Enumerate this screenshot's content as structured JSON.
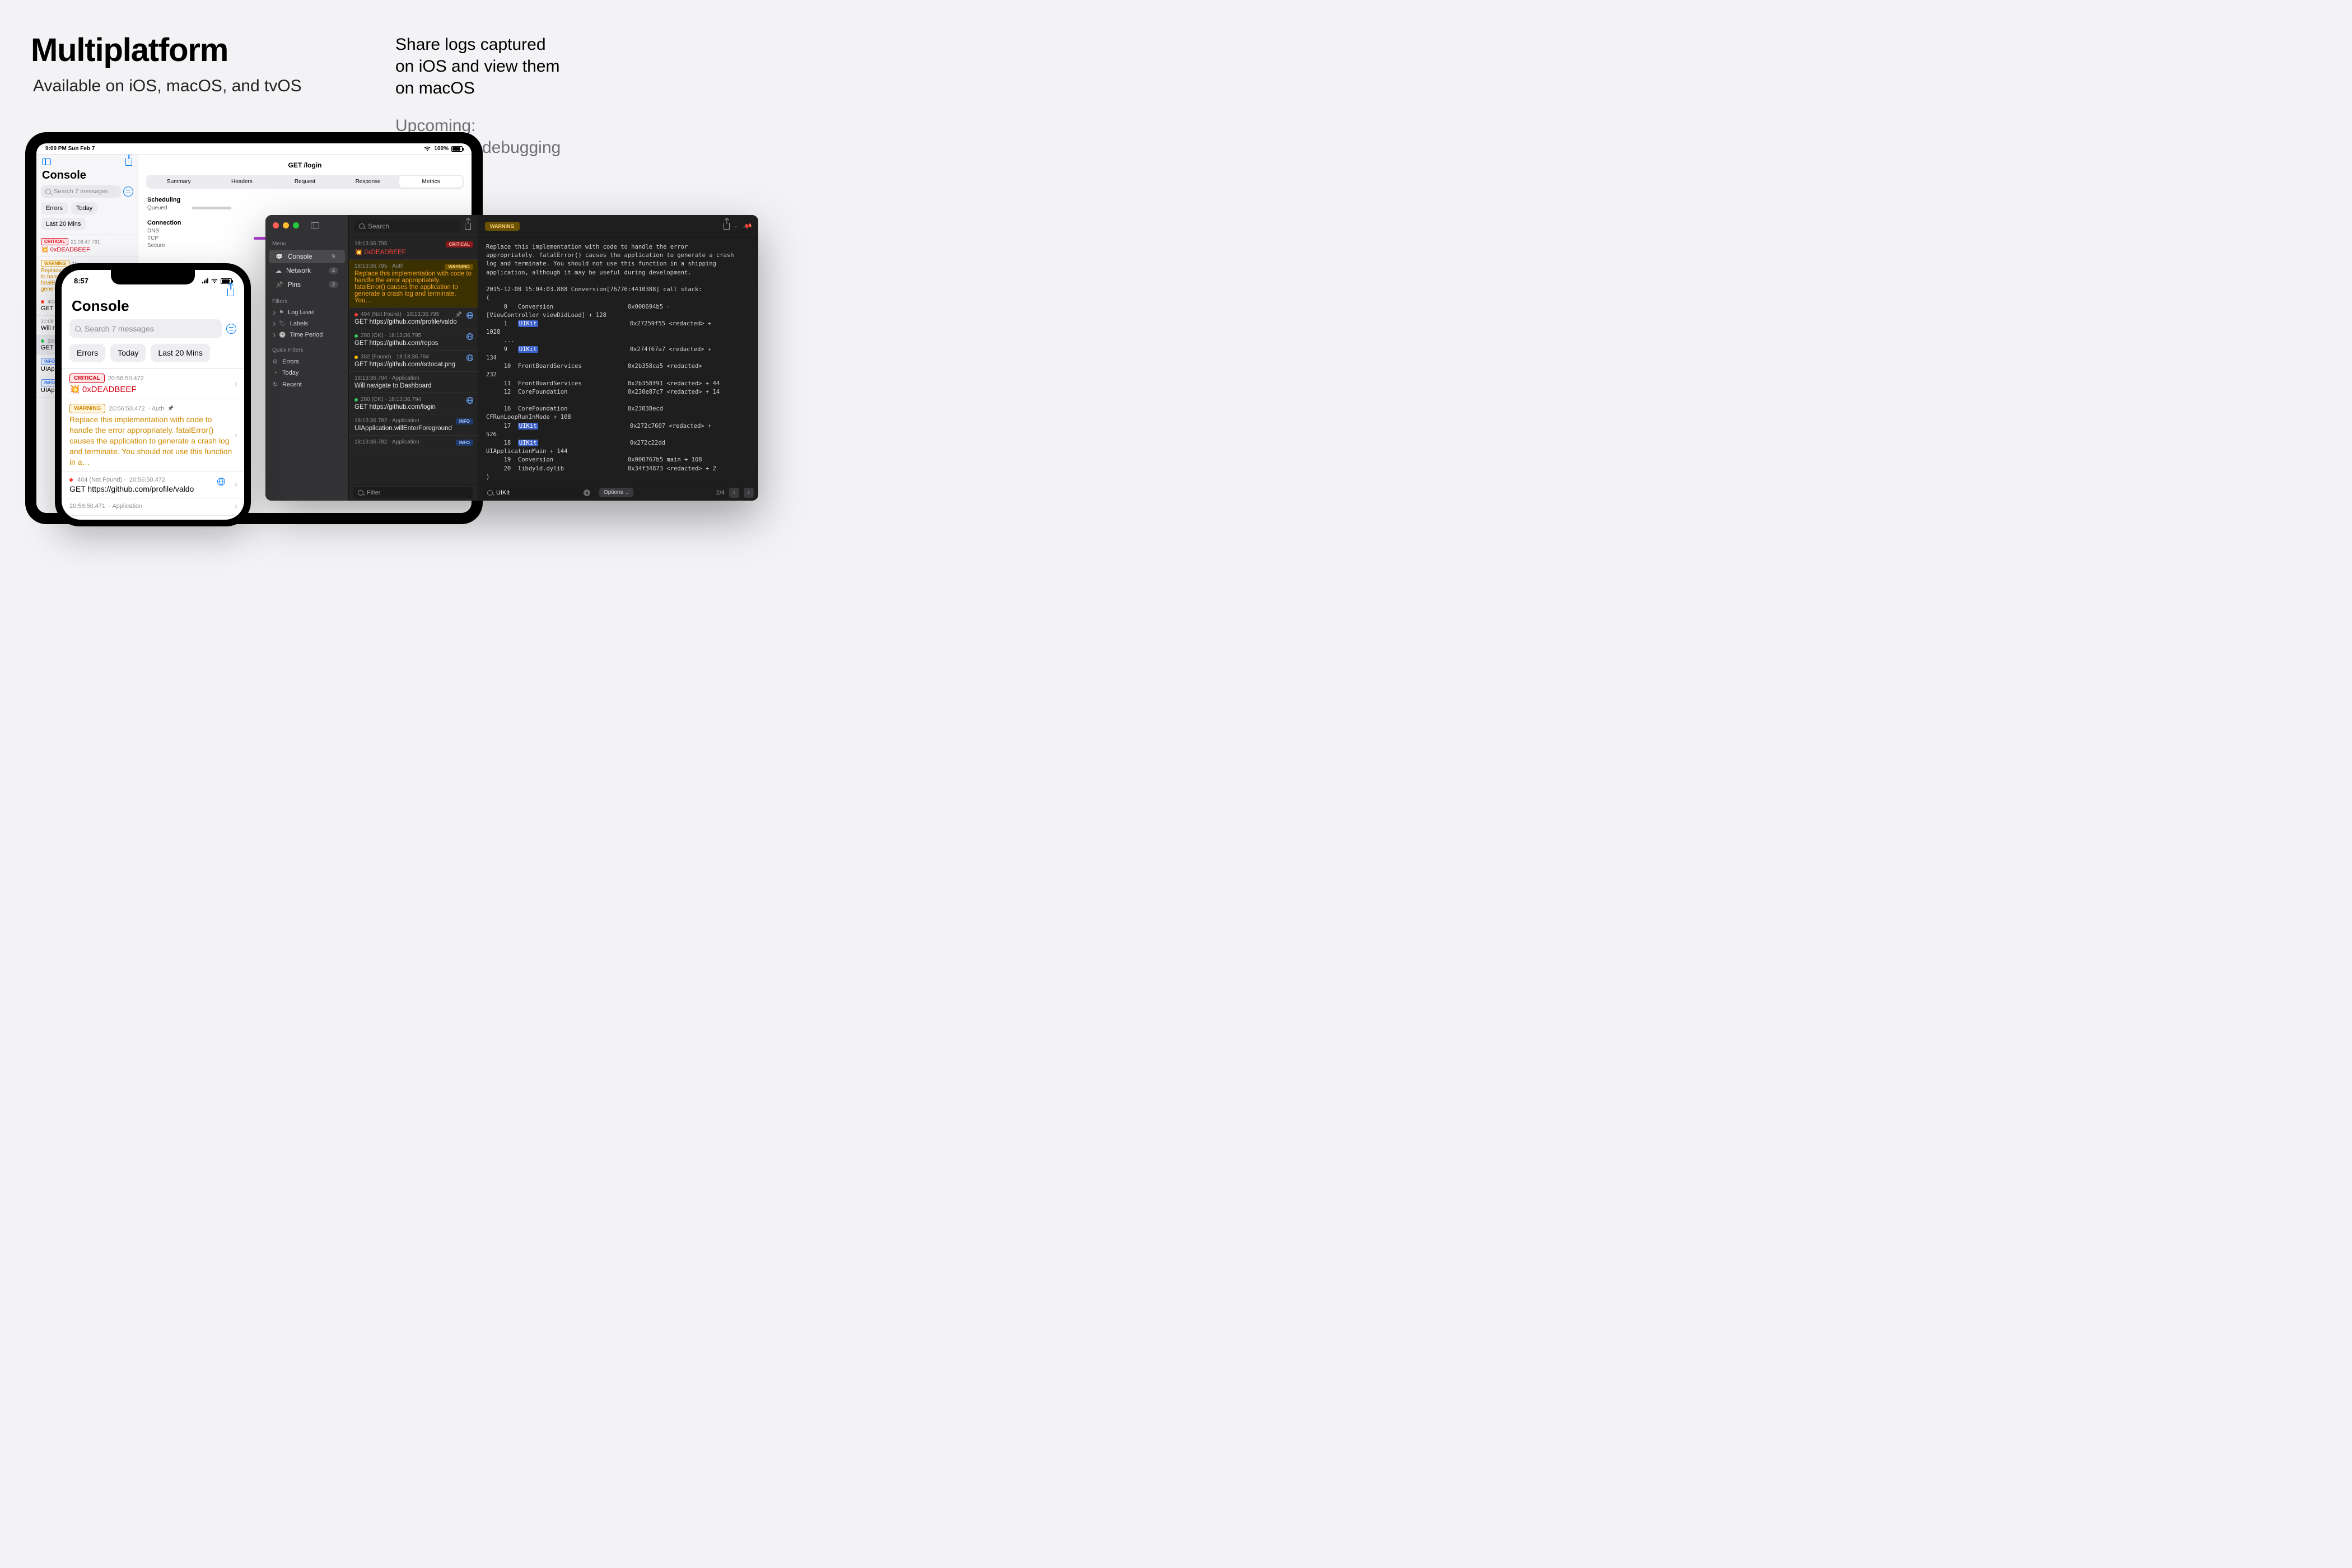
{
  "headline": {
    "title": "Multiplatform",
    "subtitle": "Available on iOS, macOS, and tvOS"
  },
  "right_copy": {
    "line1": "Share logs captured",
    "line2": "on iOS and view them",
    "line3": "on macOS",
    "upcoming1": "Upcoming:",
    "upcoming2": "live remote debugging"
  },
  "ipad": {
    "status_left": "9:09 PM   Sun Feb 7",
    "status_right_pct": "100%",
    "console_title": "Console",
    "search_placeholder": "Search 7 messages",
    "pills": [
      "Errors",
      "Today",
      "Last 20 Mins"
    ],
    "logs": [
      {
        "badge": "CRITICAL",
        "badgeCls": "b-crit",
        "ts": "21:08:47.791",
        "line": "💥 0xDEADBEEF",
        "red": true
      },
      {
        "badge": "WARNING",
        "badgeCls": "b-warn",
        "ts": "21",
        "line": "Replace t\nto handle\nfatalErro\ngenerate",
        "warn": true
      },
      {
        "dot": "d-red",
        "pre": "404 (N",
        "ts": "",
        "line": "GET htt"
      },
      {
        "ts": "21:08:47",
        "line": "Will navi"
      },
      {
        "dot": "d-green",
        "pre": "200 (O",
        "ts": "",
        "line": "GET htt",
        "sel": true
      },
      {
        "badge": "INFO",
        "badgeCls": "b-info",
        "ts": "21",
        "line": "UIApplic"
      },
      {
        "badge": "INFO",
        "badgeCls": "b-info",
        "ts": "21",
        "line": "UIApplic"
      }
    ],
    "main_title": "GET /login",
    "tabs": [
      "Summary",
      "Headers",
      "Request",
      "Response",
      "Metrics"
    ],
    "active_tab": 4,
    "scheduling_label": "Scheduling",
    "scheduling_rows": [
      [
        "Queued",
        ""
      ]
    ],
    "connection_label": "Connection",
    "connection_rows": [
      [
        "DNS",
        ""
      ],
      [
        "TCP",
        ""
      ],
      [
        "Secure",
        ""
      ]
    ]
  },
  "iphone": {
    "time": "8:57",
    "title": "Console",
    "search_placeholder": "Search 7 messages",
    "pills": [
      "Errors",
      "Today",
      "Last 20 Mins"
    ],
    "logs": [
      {
        "badge": "CRITICAL",
        "ts": "20:56:50.472",
        "body": "💥 0xDEADBEEF",
        "crit": true
      },
      {
        "badge": "WARNING",
        "ts": "20:56:50.472",
        "extra": "Auth",
        "pin": true,
        "body": "Replace this implementation with code to handle the error appropriately. fatalError() causes the application to generate a crash log and terminate. You should not use this function in a…",
        "warn": true
      },
      {
        "dot": "d-red",
        "status": "404 (Not Found)",
        "ts": "20:56:50.472",
        "body": "GET https://github.com/profile/valdo",
        "globe": true
      },
      {
        "ts": "20:56:50.471",
        "extra": "Application",
        "body": ""
      }
    ]
  },
  "mac": {
    "search_placeholder": "Search",
    "menu_label": "Menu",
    "menu": [
      {
        "icon": "bubble",
        "label": "Console",
        "count": "9",
        "on": true
      },
      {
        "icon": "cloud",
        "label": "Network",
        "count": "4"
      },
      {
        "icon": "pin",
        "label": "Pins",
        "count": "2"
      }
    ],
    "filters_label": "Filters",
    "filters": [
      "Log Level",
      "Labels",
      "Time Period"
    ],
    "quick_label": "Quick Filters",
    "quick": [
      {
        "icon": "⊘",
        "label": "Errors"
      },
      {
        "icon": "◔",
        "label": "Today"
      },
      {
        "icon": "↻",
        "label": "Recent"
      }
    ],
    "logs": [
      {
        "ts": "18:13:36.795",
        "badge": "CRITICAL",
        "bcls": "db-crit",
        "body": "💥 0xDEADBEEF",
        "red": true
      },
      {
        "ts": "18:13:36.795",
        "extra": "Auth",
        "badge": "WARNING",
        "bcls": "db-warn",
        "sel": true,
        "body": "Replace this implementation with code to handle the error appropriately. fatalError() causes the application to generate a crash log and terminate. You…"
      },
      {
        "dot": "d-red",
        "status": "404 (Not Found)",
        "ts": "18:13:36.795",
        "pin": true,
        "globe": true,
        "body": "GET https://github.com/profile/valdo"
      },
      {
        "dot": "d-green",
        "status": "200 (OK)",
        "ts": "18:13:36.795",
        "globe": true,
        "body": "GET https://github.com/repos"
      },
      {
        "dot": "d-amber",
        "status": "302 (Found)",
        "ts": "18:13:36.794",
        "globe": true,
        "body": "GET https://github.com/octocat.png"
      },
      {
        "ts": "18:13:36.794",
        "extra": "Application",
        "body": "Will navigate to Dashboard"
      },
      {
        "dot": "d-green",
        "status": "200 (OK)",
        "ts": "18:13:36.794",
        "globe": true,
        "body": "GET https://github.com/login"
      },
      {
        "ts": "18:13:36.782",
        "extra": "Application",
        "badge": "INFO",
        "bcls": "db-info",
        "body": "UIApplication.willEnterForeground"
      },
      {
        "ts": "18:13:36.782",
        "extra": "Application",
        "badge": "INFO",
        "bcls": "db-info",
        "body": ""
      }
    ],
    "filter_placeholder": "Filter",
    "detail_badge": "WARNING",
    "detail_text_pre": "Replace this implementation with code to handle the error\nappropriately. fatalError() causes the application to generate a crash\nlog and terminate. You should not use this function in a shipping\napplication, although it may be useful during development.\n\n2015-12-08 15:04:03.888 Conversion[76776:4410388] call stack:\n(\n     0   Conversion                     0x000694b5 -\n[ViewController viewDidLoad] + 128\n     1   ",
    "u1": "UIKit",
    "t1": "                          0x27259f55 <redacted> +\n1028\n     ...\n     9   ",
    "u2": "UIKit",
    "t2": "                          0x274f67a7 <redacted> +\n134\n     10  FrontBoardServices             0x2b358ca5 <redacted>\n232\n     11  FrontBoardServices             0x2b358f91 <redacted> + 44\n     12  CoreFoundation                 0x230e87c7 <redacted> + 14\n\n     16  CoreFoundation                 0x23038ecd\nCFRunLoopRunInMode + 108\n     17  ",
    "u3": "UIKit",
    "t3": "                          0x272c7607 <redacted> +\n526\n     18  ",
    "u4": "UIKit",
    "t4": "                          0x272c22dd\nUIApplicationMain + 144\n     19  Conversion                     0x000767b5 main + 108\n     20  libdyld.dylib                  0x34f34873 <redacted> + 2\n)",
    "search_value": "UIKit",
    "options_label": "Options",
    "match_count": "2/4"
  }
}
